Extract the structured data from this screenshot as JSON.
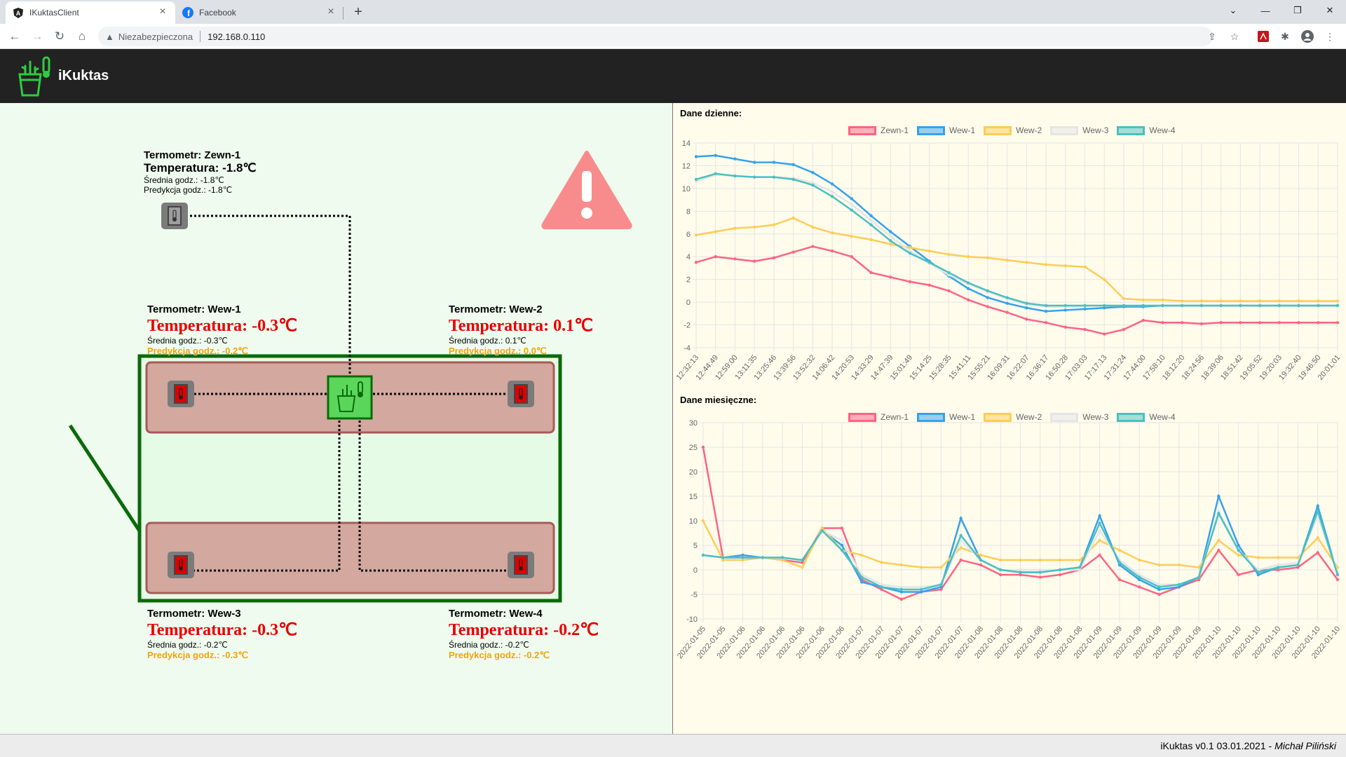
{
  "browser": {
    "tabs": [
      {
        "title": "IKuktasClient",
        "active": true
      },
      {
        "title": "Facebook",
        "active": false
      }
    ],
    "address": {
      "security": "Niezabezpieczona",
      "url": "192.168.0.110"
    }
  },
  "app": {
    "title": "iKuktas"
  },
  "thermometers": {
    "zewn1": {
      "name": "Termometr: Zewn-1",
      "temp": "Temperatura: -1.8℃",
      "avg": "Średnia godz.: -1.8℃",
      "pred": "Predykcja godz.: -1.8℃"
    },
    "wew1": {
      "name": "Termometr: Wew-1",
      "temp": "Temperatura: -0.3℃",
      "avg": "Średnia godz.: -0.3℃",
      "pred": "Predykcja godz.: -0.2℃"
    },
    "wew2": {
      "name": "Termometr: Wew-2",
      "temp": "Temperatura: 0.1℃",
      "avg": "Średnia godz.: 0.1℃",
      "pred": "Predykcja godz.: 0.0℃"
    },
    "wew3": {
      "name": "Termometr: Wew-3",
      "temp": "Temperatura: -0.3℃",
      "avg": "Średnia godz.: -0.2℃",
      "pred": "Predykcja godz.: -0.3℃"
    },
    "wew4": {
      "name": "Termometr: Wew-4",
      "temp": "Temperatura: -0.2℃",
      "avg": "Średnia godz.: -0.2℃",
      "pred": "Predykcja godz.: -0.2℃"
    }
  },
  "colors": {
    "zewn1": "#ff6384",
    "wew1": "#36a2eb",
    "wew2": "#ffcd56",
    "wew3": "#e4e5e7",
    "wew4": "#4bc0c0",
    "alert": "#f88c8c"
  },
  "footer": {
    "version": "iKuktas v0.1 03.01.2021 - ",
    "author": "Michał Piliński"
  },
  "chart_data": [
    {
      "type": "line",
      "title": "Dane dzienne:",
      "ylim": [
        -4,
        14
      ],
      "yticks": [
        14,
        12,
        10,
        8,
        6,
        4,
        2,
        0,
        -2,
        -4
      ],
      "categories": [
        "12:32:13",
        "12:44:49",
        "12:59:00",
        "13:11:35",
        "13:25:46",
        "13:39:56",
        "13:52:32",
        "14:06:42",
        "14:20:53",
        "14:33:29",
        "14:47:39",
        "15:01:49",
        "15:14:25",
        "15:28:35",
        "15:41:11",
        "15:55:21",
        "16:09:31",
        "16:22:07",
        "16:36:17",
        "16:50:28",
        "17:03:03",
        "17:17:13",
        "17:31:24",
        "17:44:00",
        "17:58:10",
        "18:12:20",
        "18:24:56",
        "18:39:06",
        "18:51:42",
        "19:05:52",
        "19:20:03",
        "19:32:40",
        "19:46:50",
        "20:01:01"
      ],
      "legend": "top",
      "series": [
        {
          "name": "Zewn-1",
          "values": [
            3.5,
            4.0,
            3.8,
            3.6,
            3.9,
            4.4,
            4.9,
            4.5,
            4.0,
            2.6,
            2.2,
            1.8,
            1.5,
            1.0,
            0.2,
            -0.4,
            -0.9,
            -1.5,
            -1.8,
            -2.2,
            -2.4,
            -2.8,
            -2.4,
            -1.6,
            -1.8,
            -1.8,
            -1.9,
            -1.8,
            -1.8,
            -1.8,
            -1.8,
            -1.8,
            -1.8,
            -1.8
          ]
        },
        {
          "name": "Wew-1",
          "values": [
            12.8,
            12.9,
            12.6,
            12.3,
            12.3,
            12.1,
            11.4,
            10.4,
            9.1,
            7.6,
            6.2,
            4.9,
            3.6,
            2.3,
            1.2,
            0.4,
            -0.1,
            -0.5,
            -0.8,
            -0.7,
            -0.6,
            -0.5,
            -0.4,
            -0.4,
            -0.3,
            -0.3,
            -0.3,
            -0.3,
            -0.3,
            -0.3,
            -0.3,
            -0.3,
            -0.3,
            -0.3
          ]
        },
        {
          "name": "Wew-2",
          "values": [
            5.9,
            6.2,
            6.5,
            6.6,
            6.8,
            7.4,
            6.6,
            6.1,
            5.8,
            5.5,
            5.1,
            4.8,
            4.5,
            4.2,
            4.0,
            3.9,
            3.7,
            3.5,
            3.3,
            3.2,
            3.1,
            2.0,
            0.3,
            0.2,
            0.2,
            0.1,
            0.1,
            0.1,
            0.1,
            0.1,
            0.1,
            0.1,
            0.1,
            0.1
          ]
        },
        {
          "name": "Wew-3",
          "values": [
            10.6,
            11.2,
            11.1,
            11.0,
            11.0,
            10.9,
            10.5,
            9.7,
            8.6,
            7.2,
            5.8,
            4.5,
            3.4,
            2.4,
            1.6,
            0.9,
            0.3,
            -0.2,
            -0.4,
            -0.4,
            -0.3,
            -0.3,
            -0.3,
            -0.3,
            -0.3,
            -0.3,
            -0.3,
            -0.3,
            -0.3,
            -0.3,
            -0.3,
            -0.3,
            -0.3,
            -0.3
          ]
        },
        {
          "name": "Wew-4",
          "values": [
            10.8,
            11.3,
            11.1,
            11.0,
            11.0,
            10.8,
            10.3,
            9.3,
            8.1,
            6.8,
            5.4,
            4.3,
            3.5,
            2.6,
            1.7,
            1.0,
            0.4,
            -0.1,
            -0.3,
            -0.3,
            -0.3,
            -0.3,
            -0.3,
            -0.3,
            -0.3,
            -0.3,
            -0.3,
            -0.3,
            -0.3,
            -0.3,
            -0.3,
            -0.3,
            -0.3,
            -0.3
          ]
        }
      ]
    },
    {
      "type": "line",
      "title": "Dane miesięczne:",
      "ylim": [
        -10,
        30
      ],
      "yticks": [
        30,
        25,
        20,
        15,
        10,
        5,
        0,
        -5,
        -10
      ],
      "categories": [
        "2022-01-05",
        "2022-01-05",
        "2022-01-06",
        "2022-01-06",
        "2022-01-06",
        "2022-01-06",
        "2022-01-06",
        "2022-01-06",
        "2022-01-07",
        "2022-01-07",
        "2022-01-07",
        "2022-01-07",
        "2022-01-07",
        "2022-01-07",
        "2022-01-08",
        "2022-01-08",
        "2022-01-08",
        "2022-01-08",
        "2022-01-08",
        "2022-01-08",
        "2022-01-09",
        "2022-01-09",
        "2022-01-09",
        "2022-01-09",
        "2022-01-09",
        "2022-01-09",
        "2022-01-10",
        "2022-01-10",
        "2022-01-10",
        "2022-01-10",
        "2022-01-10",
        "2022-01-10",
        "2022-01-10"
      ],
      "legend": "top",
      "series": [
        {
          "name": "Zewn-1",
          "values": [
            25,
            2.5,
            2.5,
            2.5,
            2,
            1.5,
            8.5,
            8.5,
            -2,
            -4,
            -6,
            -4.5,
            -4,
            2,
            1,
            -1,
            -1,
            -1.5,
            -1,
            0,
            3,
            -2,
            -3.5,
            -5,
            -3.5,
            -2,
            4,
            -1,
            0,
            0,
            0.5,
            3.5,
            -2
          ]
        },
        {
          "name": "Wew-1",
          "values": [
            3,
            2.5,
            3,
            2.5,
            2.5,
            2,
            8,
            5,
            -2.5,
            -3.5,
            -4.5,
            -4.5,
            -3.5,
            10.5,
            2,
            0,
            -0.5,
            -0.5,
            0,
            0.5,
            11,
            1,
            -2,
            -4,
            -3.5,
            -1.5,
            15,
            5,
            -1,
            0.5,
            1,
            13,
            -1
          ]
        },
        {
          "name": "Wew-2",
          "values": [
            10,
            2,
            2,
            2.5,
            2,
            0.5,
            8.5,
            4,
            3,
            1.5,
            1,
            0.5,
            0.5,
            4.5,
            3,
            2,
            2,
            2,
            2,
            2,
            6,
            4,
            2,
            1,
            1,
            0.5,
            6,
            3,
            2.5,
            2.5,
            2.5,
            6.5,
            0.5
          ]
        },
        {
          "name": "Wew-3",
          "values": [
            3,
            2.5,
            2.5,
            2.5,
            2.5,
            2,
            8,
            6,
            -1,
            -3,
            -3.5,
            -3.5,
            -3,
            6,
            2,
            0,
            0,
            0,
            0,
            0,
            8,
            2,
            -1,
            -3,
            -3,
            -1.5,
            12,
            4,
            0,
            1,
            1.5,
            11,
            -0.5
          ]
        },
        {
          "name": "Wew-4",
          "values": [
            3,
            2.5,
            2.5,
            2.5,
            2.5,
            2,
            8,
            4,
            -1.5,
            -3.5,
            -4,
            -4,
            -3,
            7,
            2,
            0,
            -0.5,
            -0.5,
            0,
            0.5,
            9.5,
            1.5,
            -1.5,
            -3.5,
            -3,
            -1.5,
            11.5,
            4,
            -0.5,
            0.5,
            1,
            12,
            -1
          ]
        }
      ]
    }
  ]
}
